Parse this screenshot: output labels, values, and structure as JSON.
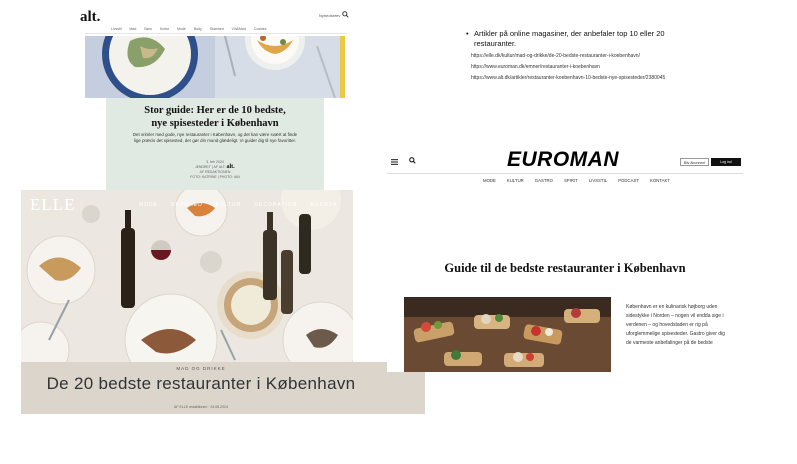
{
  "alt": {
    "logo": "alt.",
    "login": "Nyhedsbrev",
    "nav": [
      "Livsstil",
      "Mad",
      "Børn",
      "Kultur",
      "Mode",
      "Bolig",
      "Skønhed",
      "Vin&Mad",
      "Cookies"
    ],
    "title_line1": "Stor guide: Her er de 10 bedste,",
    "title_line2": "nye spisesteder i København",
    "intro": "Det vrimler med gode, nye restauranter i København, og det kan være svært at finde lige præcis det spisested, der gør din mund glædeligt. Vi guider dig til nye favoritter.",
    "meta_line1": "3. feb 2024",
    "meta_line2": "ÆNDRET | AF ALT:",
    "meta_line3": "AF REDAKTIONEN",
    "meta_line4": "FOTO: KATRINE | PHOTO: IAN",
    "mini_logo": "alt."
  },
  "elle": {
    "logo": "ELLE",
    "nav": [
      "MODE",
      "SKØNHED",
      "KULTUR",
      "DECORATION",
      "AGENDA"
    ],
    "category": "MAD OG DRIKKE",
    "title": "De 20 bedste restauranter i København",
    "byline": "AF ELLE redaktionen · 24.08.2024"
  },
  "notes": {
    "bullet": "Artikler på online magasiner, der anbefaler top 10 eller 20 restauranter.",
    "urls": [
      "https://elle.dk/kultur/mad-og-drikke/de-20-bedste-restauranter-i-koebenhavn/",
      "https://www.euroman.dk/emner/restauranter-i-koebenhavn",
      "https://www.alt.dk/artikler/restauranter-koebenhavn-10-bedste-nye-spisesteder/2380045"
    ]
  },
  "euroman": {
    "logo": "EUROMAN",
    "newsletter": "Bliv Abonnent",
    "login": "Log ind",
    "nav": [
      "MODE",
      "KULTUR",
      "GASTRO",
      "SPIRIT",
      "LIVSSTIL",
      "PODCAST",
      "KONTAKT"
    ],
    "headline": "Guide til de bedste restauranter i København",
    "body": "København er en kulinarisk højborg uden sidestykke i Norden – nogen vil endda sige i verdenen – og hovedstaden er rig på uforglemmelige spisesteder. Gastro giver dig de varmeste anbefalinger på de bedste"
  },
  "colors": {
    "alt_card": "#e1e9e3",
    "elle_band": "#dbd5cc",
    "euroman_photo": "#3b2a1f"
  }
}
